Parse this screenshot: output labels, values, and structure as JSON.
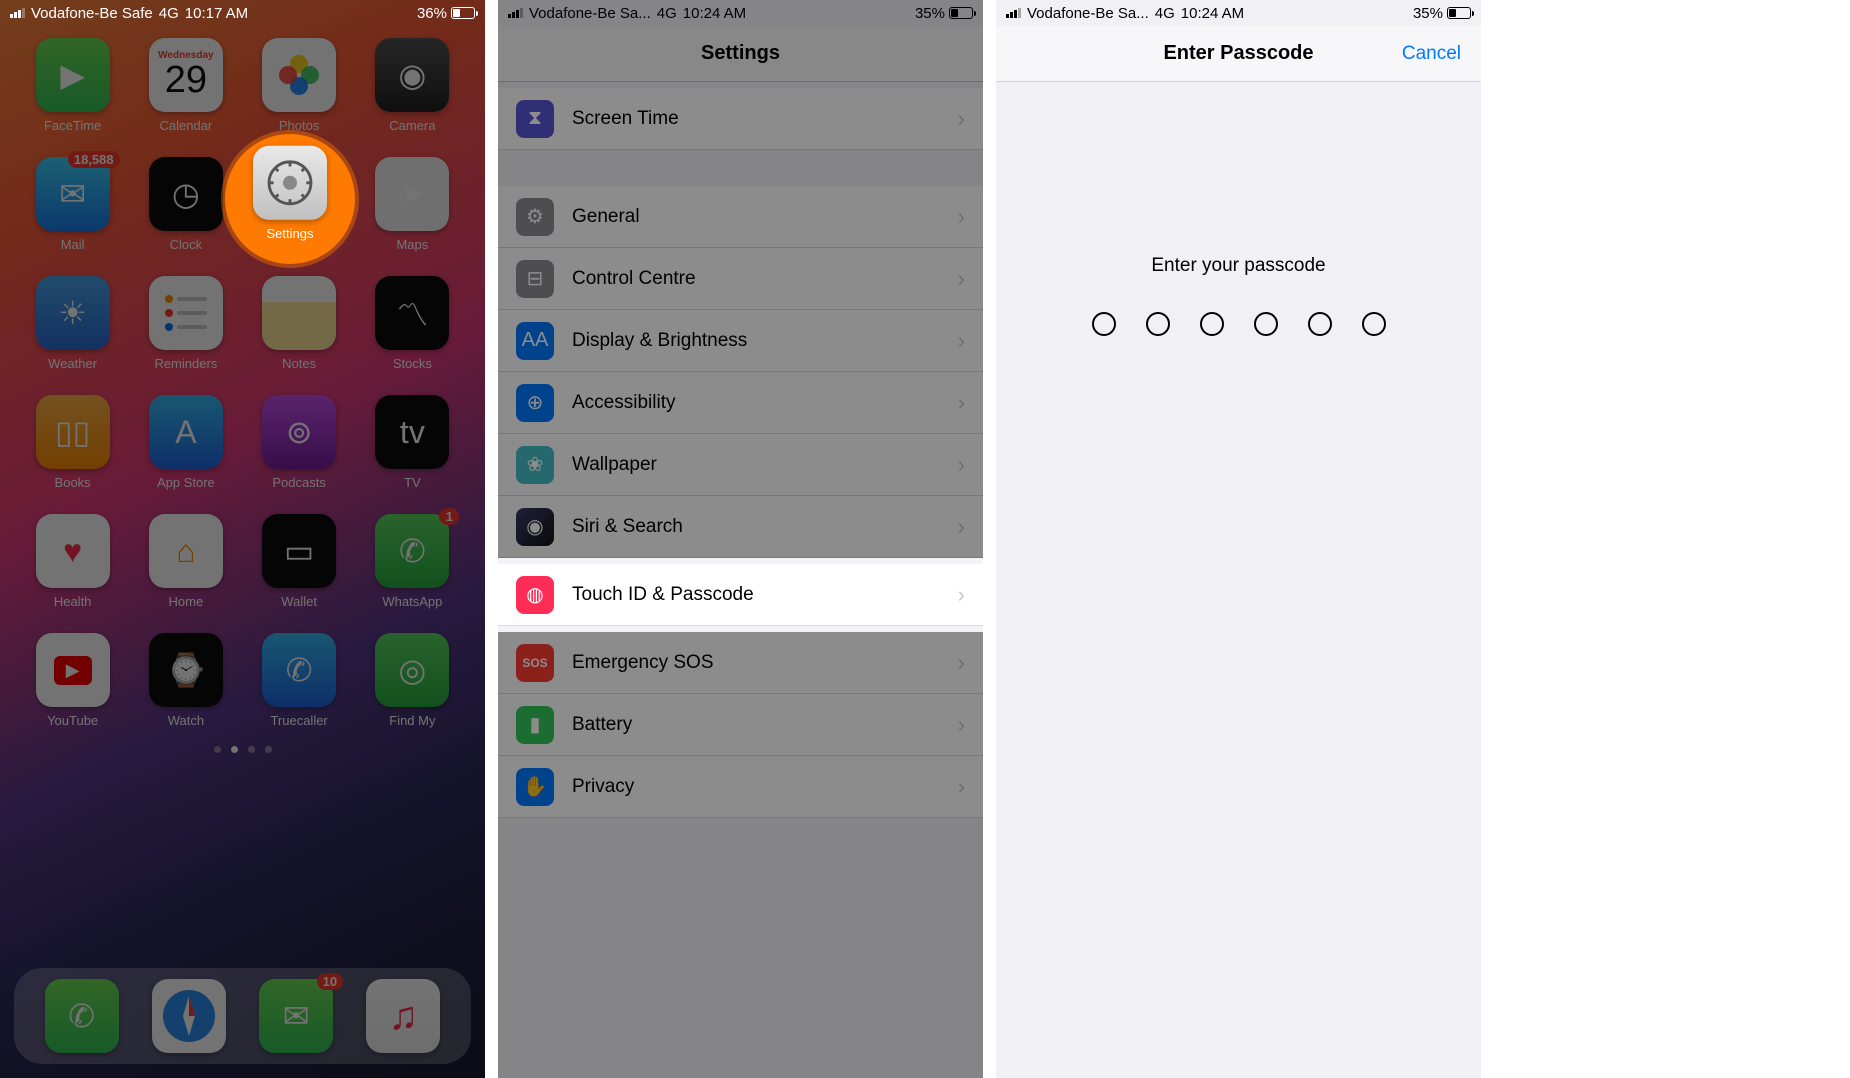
{
  "panel1": {
    "status": {
      "carrier": "Vodafone-Be Safe",
      "network": "4G",
      "time": "10:17 AM",
      "battery_pct": "36%",
      "battery_fill": 36
    },
    "calendar": {
      "dow": "Wednesday",
      "day": "29"
    },
    "apps": [
      {
        "label": "FaceTime",
        "icon": "ic-facetime",
        "glyph": "▶"
      },
      {
        "label": "Calendar",
        "icon": "ic-calendar"
      },
      {
        "label": "Photos",
        "icon": "ic-photos",
        "glyph": "✿"
      },
      {
        "label": "Camera",
        "icon": "ic-camera",
        "glyph": "◉"
      },
      {
        "label": "Mail",
        "icon": "ic-mail",
        "glyph": "✉",
        "badge": "18,588"
      },
      {
        "label": "Clock",
        "icon": "ic-clock",
        "glyph": "◷"
      },
      {
        "label": "Settings",
        "icon": "ic-settings",
        "glyph": "⚙",
        "highlight": true
      },
      {
        "label": "Maps",
        "icon": "ic-maps",
        "glyph": "➤"
      },
      {
        "label": "Weather",
        "icon": "ic-weather",
        "glyph": "☀"
      },
      {
        "label": "Reminders",
        "icon": "ic-reminders",
        "glyph": "≡"
      },
      {
        "label": "Notes",
        "icon": "ic-notes",
        "glyph": ""
      },
      {
        "label": "Stocks",
        "icon": "ic-stocks",
        "glyph": "〽"
      },
      {
        "label": "Books",
        "icon": "ic-books",
        "glyph": "▯▯"
      },
      {
        "label": "App Store",
        "icon": "ic-appstore",
        "glyph": "A"
      },
      {
        "label": "Podcasts",
        "icon": "ic-podcasts",
        "glyph": "⊚"
      },
      {
        "label": "TV",
        "icon": "ic-tv",
        "glyph": "tv"
      },
      {
        "label": "Health",
        "icon": "ic-health",
        "glyph": "♥"
      },
      {
        "label": "Home",
        "icon": "ic-home",
        "glyph": "⌂"
      },
      {
        "label": "Wallet",
        "icon": "ic-wallet",
        "glyph": "▭"
      },
      {
        "label": "WhatsApp",
        "icon": "ic-whatsapp",
        "glyph": "✆",
        "badge": "1"
      },
      {
        "label": "YouTube",
        "icon": "ic-youtube",
        "glyph": "▶"
      },
      {
        "label": "Watch",
        "icon": "ic-watch",
        "glyph": "⌚"
      },
      {
        "label": "Truecaller",
        "icon": "ic-truecaller",
        "glyph": "✆"
      },
      {
        "label": "Find My",
        "icon": "ic-findmy",
        "glyph": "◎"
      }
    ],
    "dock": [
      {
        "label": "Phone",
        "icon": "ic-phone",
        "glyph": "✆"
      },
      {
        "label": "Safari",
        "icon": "ic-safari",
        "glyph": "◎"
      },
      {
        "label": "Messages",
        "icon": "ic-messages",
        "glyph": "✉",
        "badge": "10"
      },
      {
        "label": "Music",
        "icon": "ic-music",
        "glyph": "♫"
      }
    ]
  },
  "panel2": {
    "status": {
      "carrier": "Vodafone-Be Sa...",
      "network": "4G",
      "time": "10:24 AM",
      "battery_pct": "35%",
      "battery_fill": 35
    },
    "title": "Settings",
    "rows": [
      {
        "label": "Screen Time",
        "icon": "ri-screentime",
        "glyph": "⧗",
        "gap_after": true
      },
      {
        "label": "General",
        "icon": "ri-general",
        "glyph": "⚙"
      },
      {
        "label": "Control Centre",
        "icon": "ri-cc",
        "glyph": "⊟"
      },
      {
        "label": "Display & Brightness",
        "icon": "ri-display",
        "glyph": "AA"
      },
      {
        "label": "Accessibility",
        "icon": "ri-accessibility",
        "glyph": "⊕"
      },
      {
        "label": "Wallpaper",
        "icon": "ri-wallpaper",
        "glyph": "❀"
      },
      {
        "label": "Siri & Search",
        "icon": "ri-siri",
        "glyph": "◉"
      },
      {
        "label": "Touch ID & Passcode",
        "icon": "ri-touchid",
        "glyph": "◍",
        "highlight": true
      },
      {
        "label": "Emergency SOS",
        "icon": "ri-sos",
        "glyph": "SOS"
      },
      {
        "label": "Battery",
        "icon": "ri-battery",
        "glyph": "▮"
      },
      {
        "label": "Privacy",
        "icon": "ri-privacy",
        "glyph": "✋"
      }
    ]
  },
  "panel3": {
    "status": {
      "carrier": "Vodafone-Be Sa...",
      "network": "4G",
      "time": "10:24 AM",
      "battery_pct": "35%",
      "battery_fill": 35
    },
    "title": "Enter Passcode",
    "cancel": "Cancel",
    "prompt": "Enter your passcode",
    "digits": 6
  }
}
